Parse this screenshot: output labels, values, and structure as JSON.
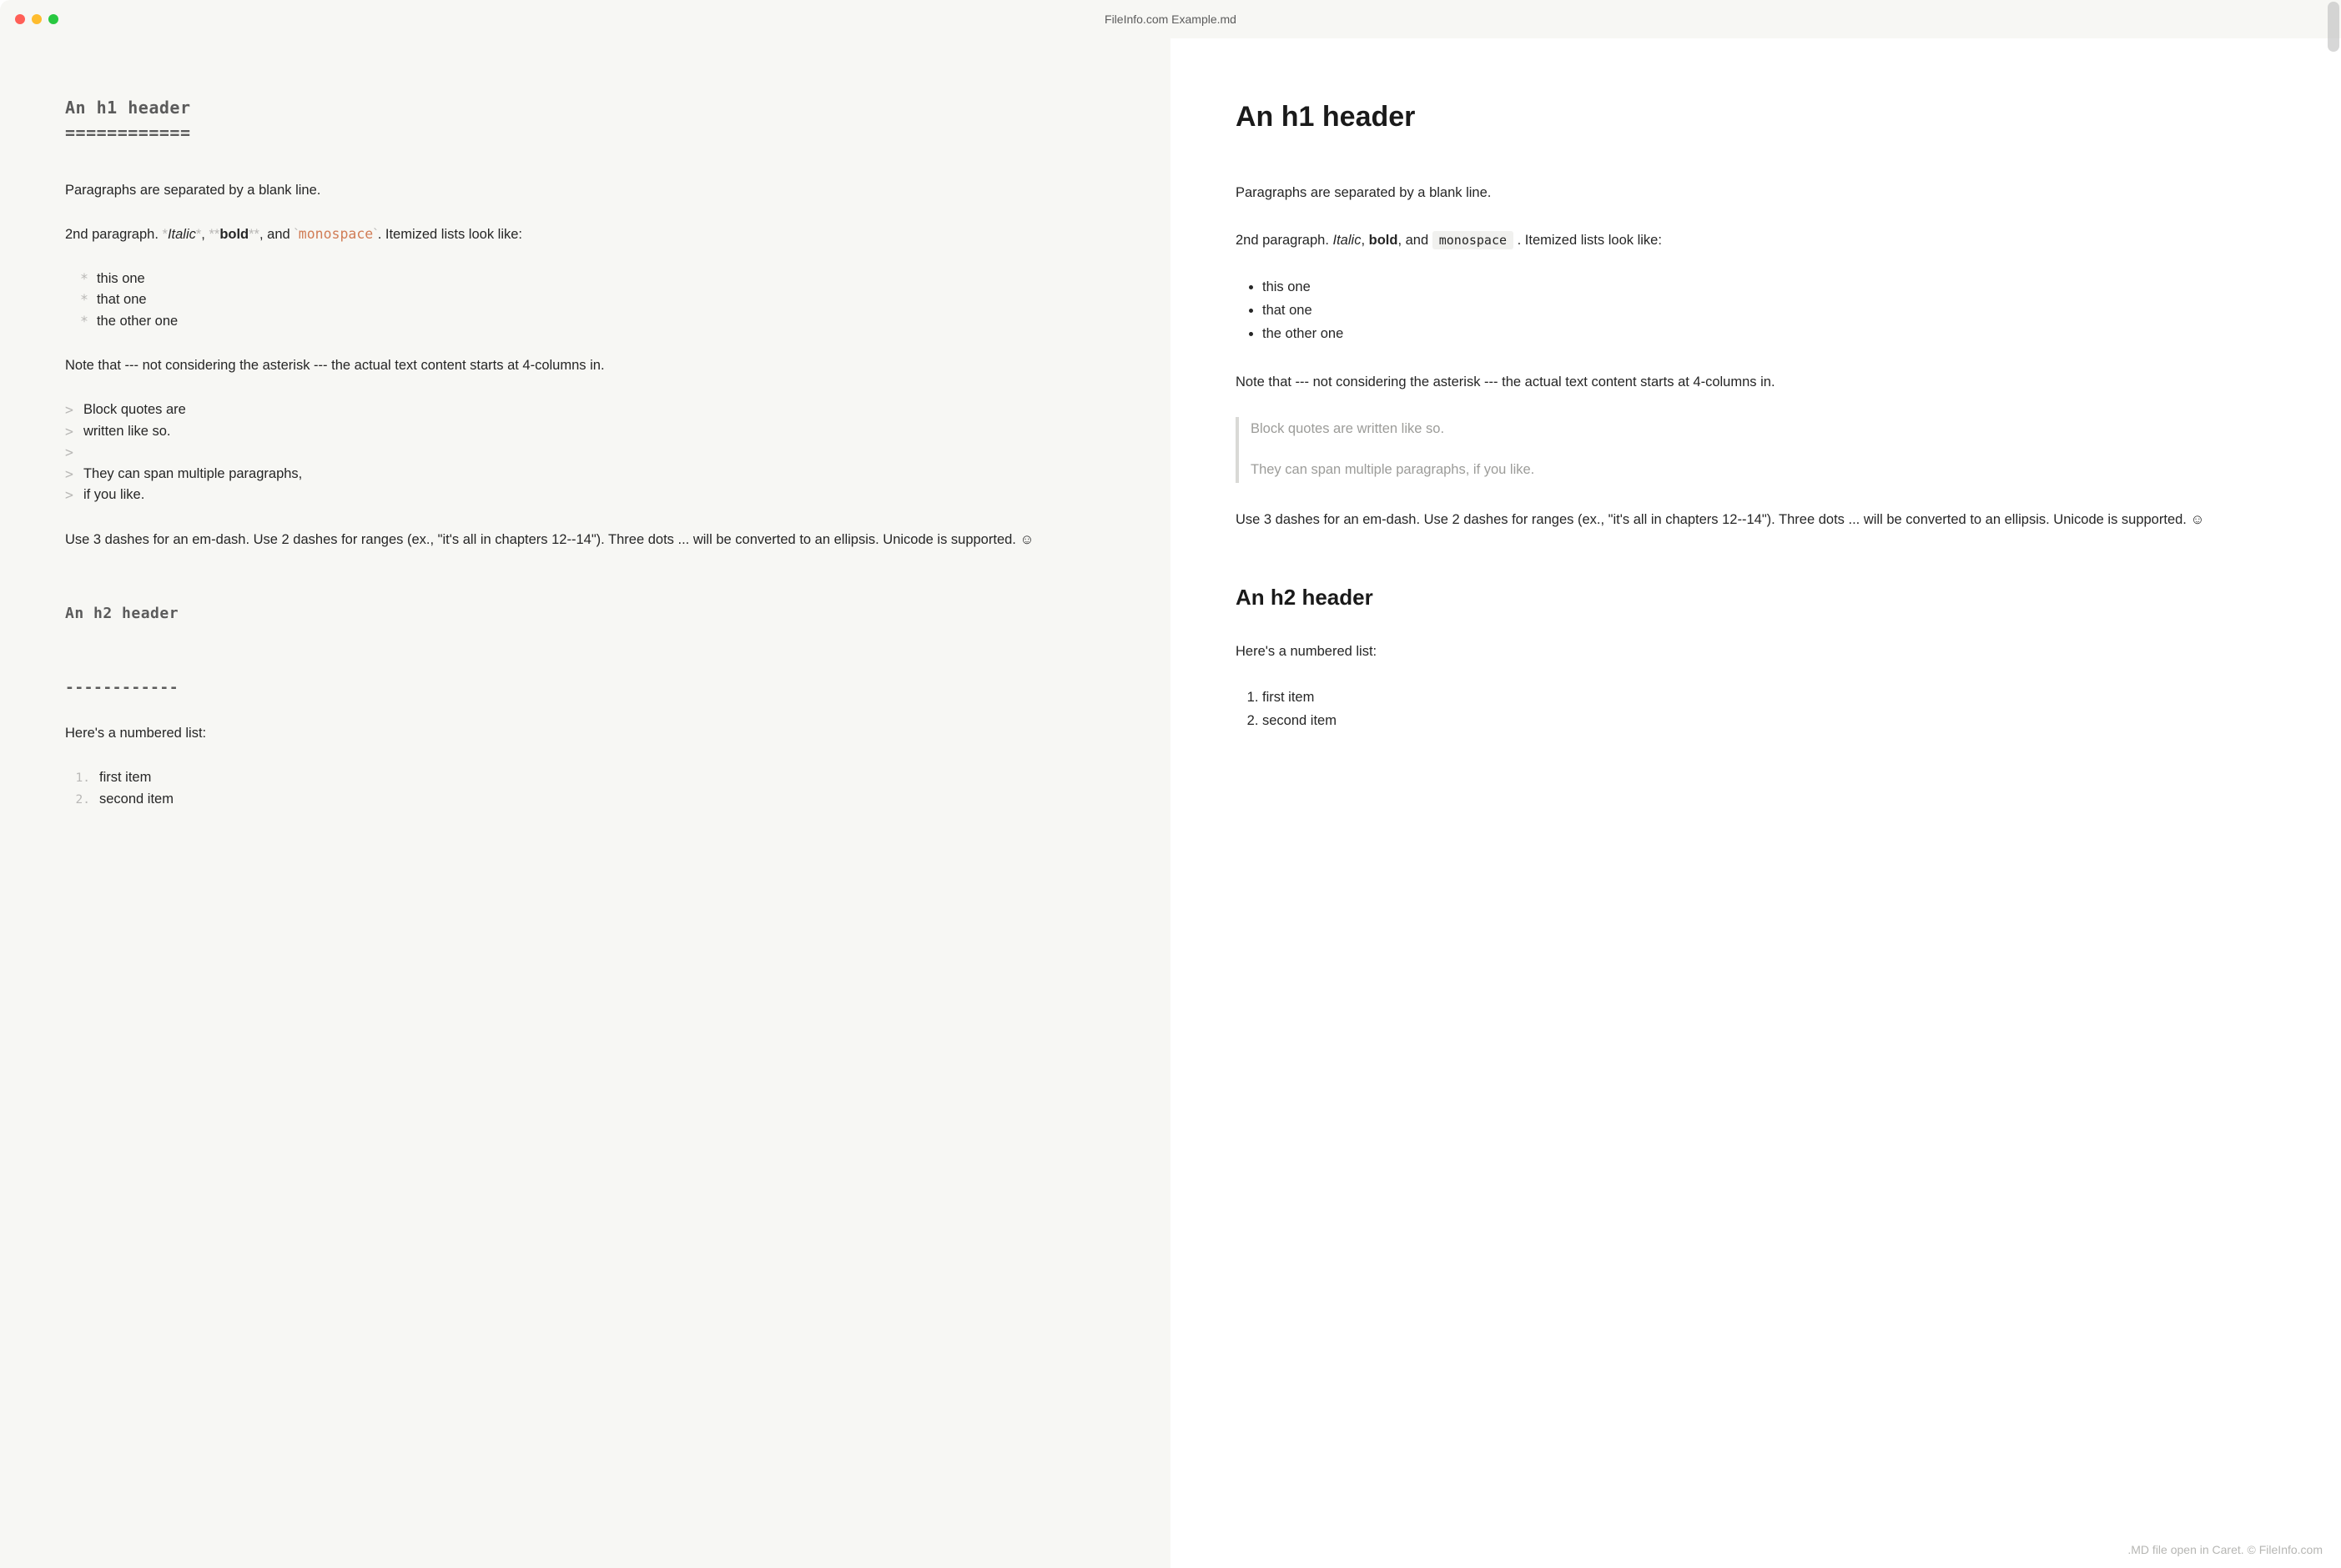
{
  "window": {
    "title": "FileInfo.com Example.md"
  },
  "source": {
    "h1_line1": "An h1 header",
    "h1_line2": "============",
    "para1": "Paragraphs are separated by a blank line.",
    "para2_pre": "2nd paragraph. ",
    "para2_italic_marker_open": "*",
    "para2_italic": "Italic",
    "para2_italic_marker_close": "*",
    "para2_sep1": ", ",
    "para2_bold_marker_open": "**",
    "para2_bold": "bold",
    "para2_bold_marker_close": "**",
    "para2_sep2": ", and ",
    "para2_code_marker_open": "`",
    "para2_code": "monospace",
    "para2_code_marker_close": "`",
    "para2_tail": ". Itemized lists look like:",
    "list": [
      "this one",
      "that one",
      "the other one"
    ],
    "note": "Note that --- not considering the asterisk --- the actual text content starts at 4-columns in.",
    "quote_lines": [
      "Block quotes are",
      "written like so.",
      "",
      "They can span multiple paragraphs,",
      "if you like."
    ],
    "para_dashes": "Use 3 dashes for an em-dash. Use 2 dashes for ranges (ex., \"it's all in chapters 12--14\"). Three dots ... will be converted to an ellipsis. Unicode is supported. ☺",
    "h2_line1": "An h2 header",
    "h2_line2": "------------",
    "numbered_intro": "Here's a numbered list:",
    "ol": [
      "first item",
      "second item"
    ]
  },
  "rendered": {
    "h1": "An h1 header",
    "para1": "Paragraphs are separated by a blank line.",
    "para2_pre": "2nd paragraph. ",
    "para2_italic": "Italic",
    "para2_sep1": ", ",
    "para2_bold": "bold",
    "para2_sep2": ", and ",
    "para2_code": "monospace",
    "para2_tail": " . Itemized lists look like:",
    "list": [
      "this one",
      "that one",
      "the other one"
    ],
    "note": "Note that --- not considering the asterisk --- the actual text content starts at 4-columns in.",
    "quote_p1": "Block quotes are written like so.",
    "quote_p2": "They can span multiple paragraphs, if you like.",
    "para_dashes": "Use 3 dashes for an em-dash. Use 2 dashes for ranges (ex., \"it's all in chapters 12--14\"). Three dots ... will be converted to an ellipsis. Unicode is supported. ☺",
    "h2": "An h2 header",
    "numbered_intro": "Here's a numbered list:",
    "ol": [
      "first item",
      "second item"
    ]
  },
  "watermark": ".MD file open in Caret. © FileInfo.com"
}
